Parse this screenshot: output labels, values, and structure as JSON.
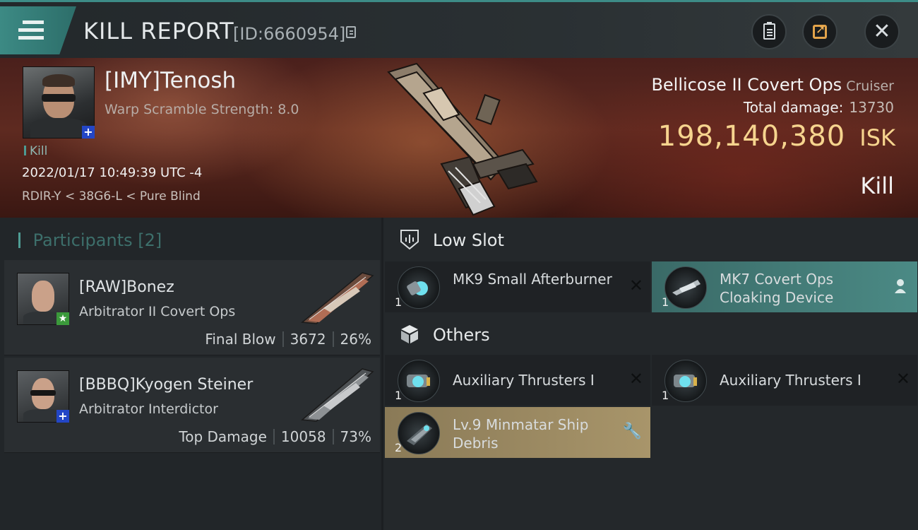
{
  "header": {
    "title": "KILL REPORT",
    "report_id": "[ID:6660954]"
  },
  "victim": {
    "name": "[IMY]Tenosh",
    "subtext": "Warp Scramble Strength: 8.0",
    "kill_tag": "Kill",
    "timestamp": "2022/01/17 10:49:39 UTC -4",
    "location": "RDIR-Y < 38G6-L < Pure Blind",
    "ship_name": "Bellicose II Covert Ops",
    "ship_class": "Cruiser",
    "total_damage_label": "Total damage:",
    "total_damage_value": "13730",
    "isk_value": "198,140,380",
    "isk_unit": "ISK",
    "result_label": "Kill"
  },
  "participants": {
    "title": "Participants",
    "count": "[2]",
    "items": [
      {
        "name": "[RAW]Bonez",
        "ship": "Arbitrator II Covert Ops",
        "role": "Final Blow",
        "damage": "3672",
        "percent": "26%"
      },
      {
        "name": "[BBBQ]Kyogen Steiner",
        "ship": "Arbitrator Interdictor",
        "role": "Top Damage",
        "damage": "10058",
        "percent": "73%"
      }
    ]
  },
  "sections": {
    "low_slot": "Low Slot",
    "others": "Others"
  },
  "modules": {
    "low": [
      {
        "name": "MK9 Small Afterburner",
        "qty": "1",
        "state": "destroyed"
      },
      {
        "name": "MK7 Covert Ops Cloaking Device",
        "qty": "1",
        "state": "dropped"
      }
    ],
    "others": [
      {
        "name": "Auxiliary Thrusters I",
        "qty": "1",
        "state": "destroyed"
      },
      {
        "name": "Auxiliary Thrusters I",
        "qty": "1",
        "state": "destroyed"
      },
      {
        "name": "Lv.9 Minmatar Ship Debris",
        "qty": "2",
        "state": "salvage"
      }
    ]
  },
  "colors": {
    "accent_teal": "#4b8a85",
    "isk_gold": "#f6d48e",
    "salvage_gold": "#a8956a",
    "share_orange": "#e2a34a"
  },
  "icons": [
    "menu-icon",
    "copy-icon",
    "clipboard-icon",
    "share-icon",
    "close-icon",
    "low-slot-icon",
    "others-cube-icon",
    "person-icon",
    "wrench-icon",
    "x-icon"
  ]
}
